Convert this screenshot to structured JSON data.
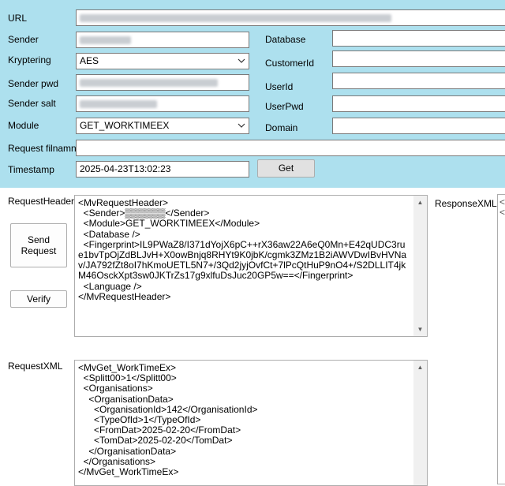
{
  "form": {
    "url_label": "URL",
    "sender_label": "Sender",
    "kryptering_label": "Kryptering",
    "kryptering_value": "AES",
    "sender_pwd_label": "Sender pwd",
    "sender_salt_label": "Sender salt",
    "module_label": "Module",
    "module_value": "GET_WORKTIMEEX",
    "request_filename_label": "Request filnamn",
    "timestamp_label": "Timestamp",
    "timestamp_value": "2025-04-23T13:02:23",
    "get_button": "Get",
    "database_label": "Database",
    "customerid_label": "CustomerId",
    "userid_label": "UserId",
    "userpwd_label": "UserPwd",
    "domain_label": "Domain"
  },
  "lower": {
    "request_header_label": "RequestHeader",
    "send_request_button": "Send\nRequest",
    "verify_button": "Verify",
    "response_xml_label": "ResponseXML",
    "request_xml_label": "RequestXML",
    "request_header_text": "<MvRequestHeader>\n  <Sender>▒▒▒▒▒▒</Sender>\n  <Module>GET_WORKTIMEEX</Module>\n  <Database />\n  <Fingerprint>IL9PWaZ8/I371dYojX6pC++rX36aw22A6eQ0Mn+E42qUDC3rue1bvTpOjZdBLJvH+X0owBnjq8RHYt9K0jbK/cgmk3ZMz1B2iAWVDwIBvHVNav/JA792fZt8oI7hKmoUETL5N7+/3Qd2jyjOvfCt+7lPcQtHuP9nO4+/S2DLLIT4jkM46OsckXpt3sw0JKTrZs17g9xlfuDsJuc20GP5w==</Fingerprint>\n  <Language />\n</MvRequestHeader>",
    "request_xml_text": "<MvGet_WorkTimeEx>\n  <Splitt00>1</Splitt00>\n  <Organisations>\n    <OrganisationData>\n      <OrganisationId>142</OrganisationId>\n      <TypeOfId>1</TypeOfId>\n      <FromDat>2025-02-20</FromDat>\n      <TomDat>2025-02-20</TomDat>\n    </OrganisationData>\n  </Organisations>\n</MvGet_WorkTimeEx>"
  },
  "icons": {
    "dropdown": "chevron-down-icon",
    "scroll_up": "scroll-up-arrow-icon",
    "scroll_down": "scroll-down-arrow-icon"
  },
  "colors": {
    "top_panel": "#ade0ee",
    "background": "#ffffff"
  }
}
